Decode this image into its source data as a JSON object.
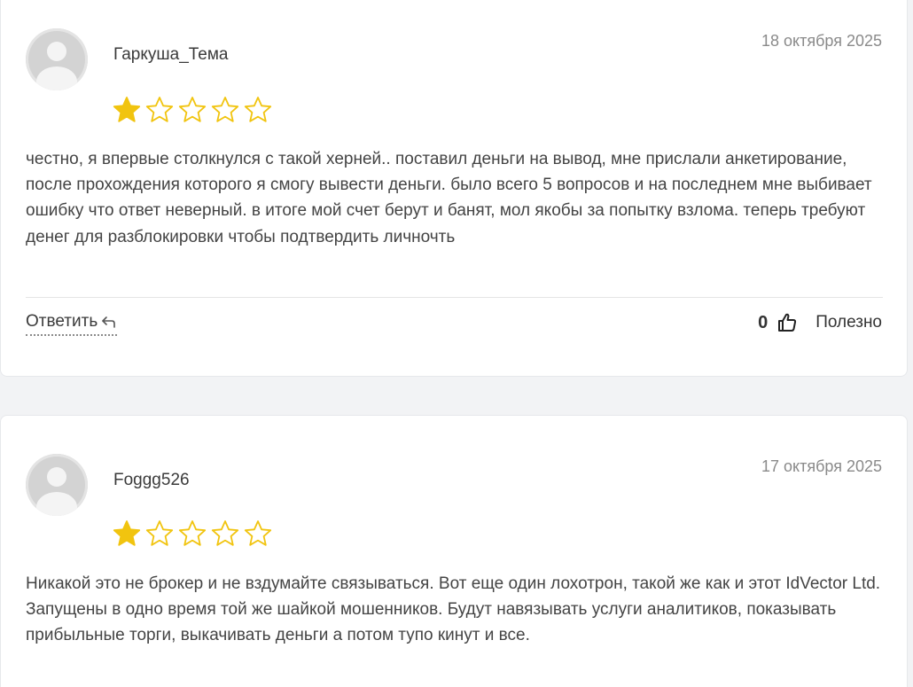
{
  "colors": {
    "star_filled": "#f1c40f",
    "star_empty_stroke": "#f1c40f"
  },
  "reviews": [
    {
      "author": "Гаркуша_Тема",
      "date": "18 октября 2025",
      "rating": 1,
      "max_rating": 5,
      "text": "честно, я впервые столкнулся с такой херней.. поставил деньги на вывод, мне прислали анкетирование, после прохождения которого я смогу вывести деньги. было всего 5 вопросов и на последнем мне выбивает ошибку что ответ неверный. в итоге мой счет берут и банят, мол якобы за попытку взлома. теперь требуют денег для разблокировки чтобы подтвердить личночть",
      "reply_label": "Ответить",
      "likes": "0",
      "useful_label": "Полезно"
    },
    {
      "author": "Foggg526",
      "date": "17 октября 2025",
      "rating": 1,
      "max_rating": 5,
      "text": "Никакой это не брокер и не вздумайте связываться. Вот еще один лохотрон, такой же как и этот IdVector Ltd. Запущены в одно время той же шайкой мошенников. Будут навязывать услуги аналитиков, показывать прибыльные торги, выкачивать деньги а потом тупо кинут и все."
    }
  ]
}
